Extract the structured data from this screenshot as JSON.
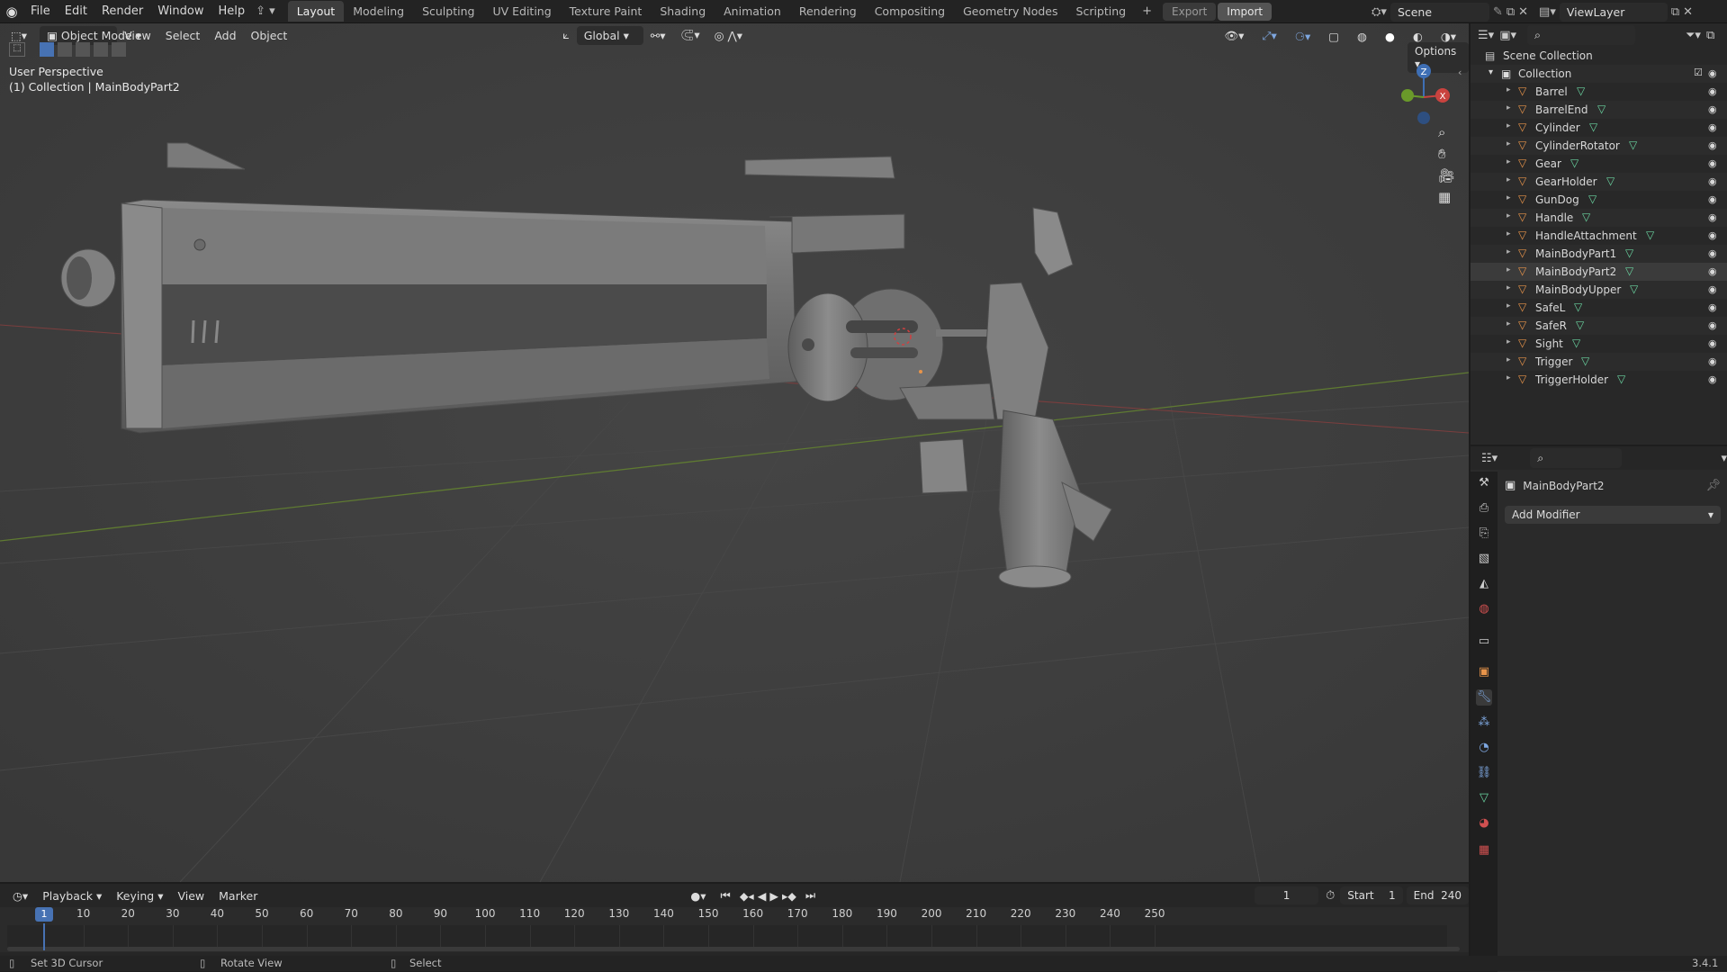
{
  "app": {
    "version": "3.4.1"
  },
  "topbar": {
    "menus": [
      "File",
      "Edit",
      "Render",
      "Window",
      "Help"
    ],
    "workspaces": [
      "Layout",
      "Modeling",
      "Sculpting",
      "UV Editing",
      "Texture Paint",
      "Shading",
      "Animation",
      "Rendering",
      "Compositing",
      "Geometry Nodes",
      "Scripting"
    ],
    "active_workspace": "Layout",
    "export_label": "Export",
    "import_label": "Import",
    "scene": "Scene",
    "view_layer": "ViewLayer"
  },
  "viewport": {
    "mode": "Object Mode",
    "menus": [
      "View",
      "Select",
      "Add",
      "Object"
    ],
    "transform_orientation": "Global",
    "options_label": "Options",
    "overlay_title": "User Perspective",
    "overlay_subtitle": "(1) Collection | MainBodyPart2",
    "gizmo": {
      "z": "Z",
      "x": "X"
    }
  },
  "outliner": {
    "root": "Scene Collection",
    "collection": "Collection",
    "items": [
      "Barrel",
      "BarrelEnd",
      "Cylinder",
      "CylinderRotator",
      "Gear",
      "GearHolder",
      "GunDog",
      "Handle",
      "HandleAttachment",
      "MainBodyPart1",
      "MainBodyPart2",
      "MainBodyUpper",
      "SafeL",
      "SafeR",
      "Sight",
      "Trigger",
      "TriggerHolder"
    ],
    "selected": "MainBodyPart2"
  },
  "properties": {
    "object_name": "MainBodyPart2",
    "add_modifier": "Add Modifier"
  },
  "timeline": {
    "menus": [
      "Playback",
      "Keying",
      "View",
      "Marker"
    ],
    "current_frame": "1",
    "start_label": "Start",
    "start": "1",
    "end_label": "End",
    "end": "240",
    "ticks": [
      "10",
      "20",
      "30",
      "40",
      "50",
      "60",
      "70",
      "80",
      "90",
      "100",
      "110",
      "120",
      "130",
      "140",
      "150",
      "160",
      "170",
      "180",
      "190",
      "200",
      "210",
      "220",
      "230",
      "240",
      "250"
    ],
    "playhead": "1"
  },
  "statusbar": {
    "hint1": "Set 3D Cursor",
    "hint2": "Rotate View",
    "hint3": "Select"
  },
  "colors": {
    "accent": "#4772b3",
    "vertex_green": "#6ad4a0",
    "object_orange": "#e8944a",
    "axis_red": "#c9433f",
    "axis_green": "#6a9a2a",
    "axis_blue": "#3e6fb5"
  }
}
